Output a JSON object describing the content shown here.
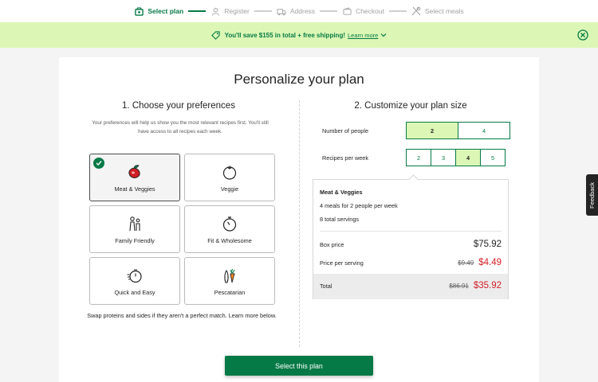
{
  "stepper": {
    "steps": [
      {
        "label": "Select plan",
        "icon": "plan-icon",
        "active": true
      },
      {
        "label": "Register",
        "icon": "user-icon",
        "active": false
      },
      {
        "label": "Address",
        "icon": "truck-icon",
        "active": false
      },
      {
        "label": "Checkout",
        "icon": "wallet-icon",
        "active": false
      },
      {
        "label": "Select meals",
        "icon": "utensils-icon",
        "active": false
      }
    ]
  },
  "promo": {
    "text": "You'll save $155 in total + free shipping!",
    "learn_more": "Learn more",
    "color": "#dcf7b5"
  },
  "main": {
    "title": "Personalize your plan",
    "preferences": {
      "heading": "1. Choose your preferences",
      "description": "Your preferences will help us show you the most relevant recipes first. You'll still have access to all recipes each week.",
      "tiles": [
        {
          "label": "Meat & Veggies",
          "icon": "meat-veggies-icon",
          "selected": true
        },
        {
          "label": "Veggie",
          "icon": "tomato-icon",
          "selected": false
        },
        {
          "label": "Family Friendly",
          "icon": "family-icon",
          "selected": false
        },
        {
          "label": "Fit & Wholesome",
          "icon": "stopwatch-icon",
          "selected": false
        },
        {
          "label": "Quick and Easy",
          "icon": "timer-icon",
          "selected": false
        },
        {
          "label": "Pescatarian",
          "icon": "fish-carrot-icon",
          "selected": false
        }
      ],
      "note": "Swap proteins and sides if they aren't a perfect match. Learn more below."
    },
    "plan_size": {
      "heading": "2. Customize your plan size",
      "people_label": "Number of people",
      "people_options": [
        "2",
        "4"
      ],
      "people_selected": "2",
      "recipes_label": "Recipes per week",
      "recipes_options": [
        "2",
        "3",
        "4",
        "5"
      ],
      "recipes_selected": "4",
      "summary": {
        "plan_name": "Meat & Veggies",
        "meals": "4 meals for 2 people per week",
        "servings": "8 total servings",
        "box_price_label": "Box price",
        "box_price": "$75.92",
        "per_serving_label": "Price per serving",
        "per_serving_old": "$9.49",
        "per_serving_new": "$4.49",
        "total_label": "Total",
        "total_old": "$86.91",
        "total_new": "$35.92"
      }
    },
    "cta": "Select this plan"
  },
  "feedback": "Feedback",
  "colors": {
    "brand_green": "#067a46",
    "light_green": "#dcf7b5",
    "discount_red": "#d01f26"
  }
}
